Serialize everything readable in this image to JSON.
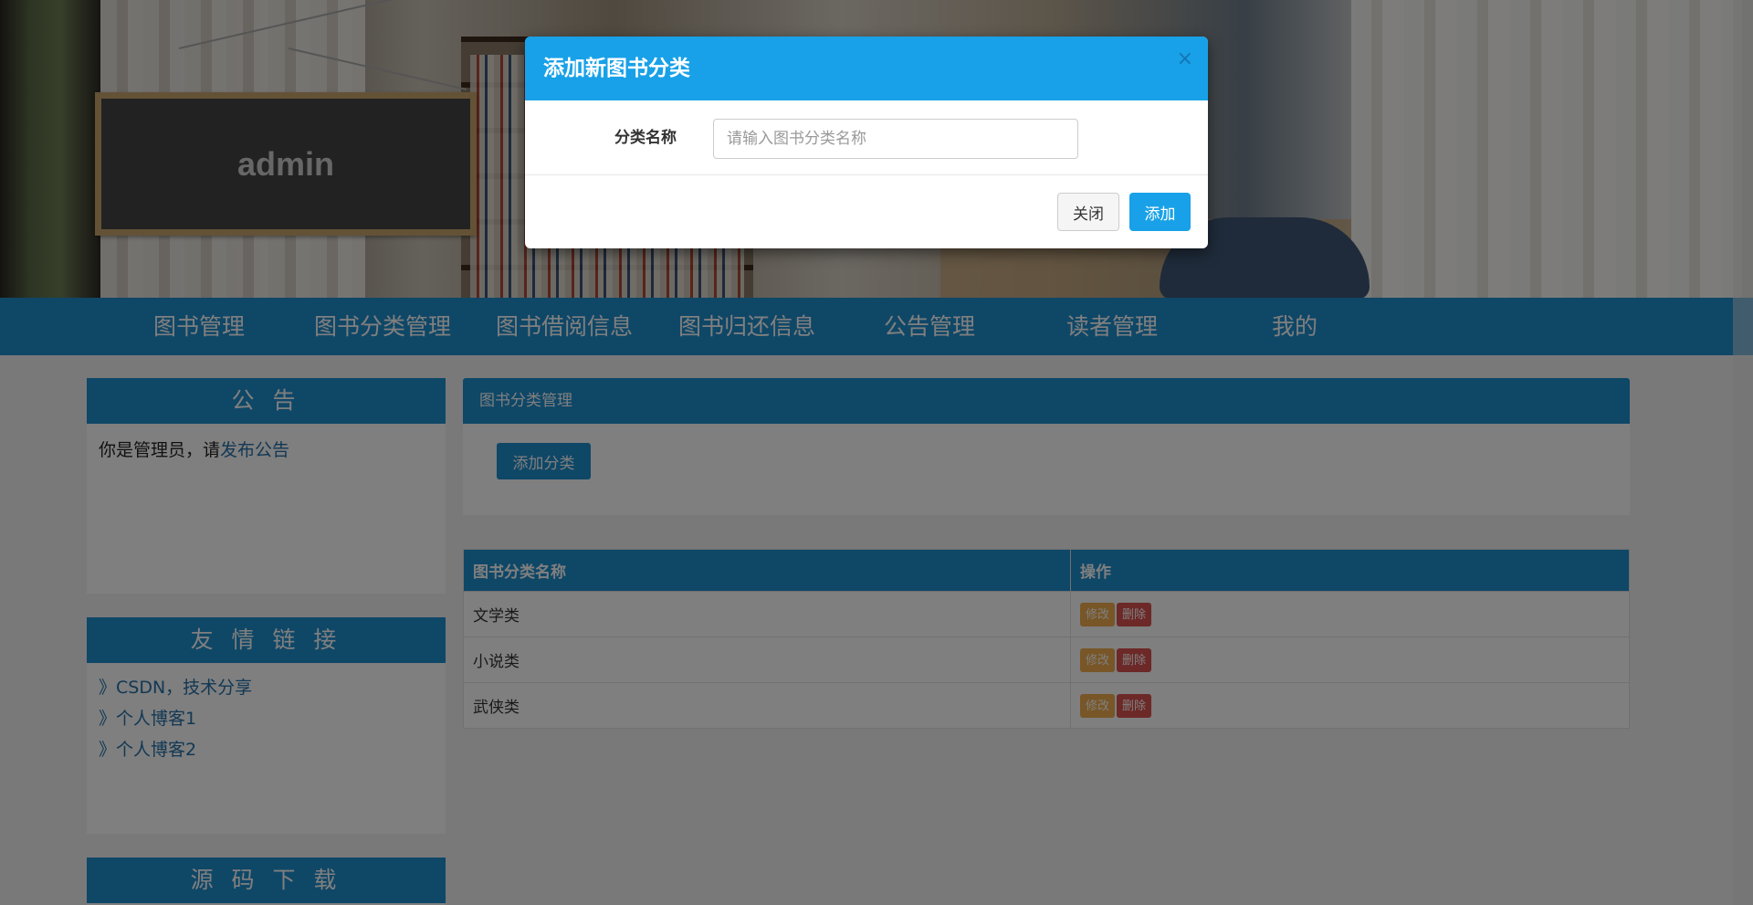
{
  "banner": {
    "username": "admin"
  },
  "nav": {
    "items": [
      {
        "label": "图书管理"
      },
      {
        "label": "图书分类管理"
      },
      {
        "label": "图书借阅信息"
      },
      {
        "label": "图书归还信息"
      },
      {
        "label": "公告管理"
      },
      {
        "label": "读者管理"
      },
      {
        "label": "我的"
      }
    ]
  },
  "sidebar": {
    "notice": {
      "title": "公 告",
      "text": "你是管理员，请",
      "link": "发布公告"
    },
    "links": {
      "title": "友 情 链 接",
      "items": [
        "》CSDN，技术分享",
        "》个人博客1",
        "》个人博客2"
      ]
    },
    "download": {
      "title": "源 码 下 载"
    }
  },
  "main": {
    "card_title": "图书分类管理",
    "add_button": "添加分类",
    "table": {
      "headers": [
        "图书分类名称",
        "操作"
      ],
      "rows": [
        {
          "name": "文学类"
        },
        {
          "name": "小说类"
        },
        {
          "name": "武侠类"
        }
      ],
      "edit_label": "修改",
      "delete_label": "删除"
    }
  },
  "modal": {
    "title": "添加新图书分类",
    "close_icon": "×",
    "field_label": "分类名称",
    "field_placeholder": "请输入图书分类名称",
    "close_button": "关闭",
    "submit_button": "添加"
  },
  "colors": {
    "primary": "#1e8fcf",
    "modal_header": "#18a1e8",
    "edit": "#f0ad4e",
    "delete": "#d9534f"
  }
}
